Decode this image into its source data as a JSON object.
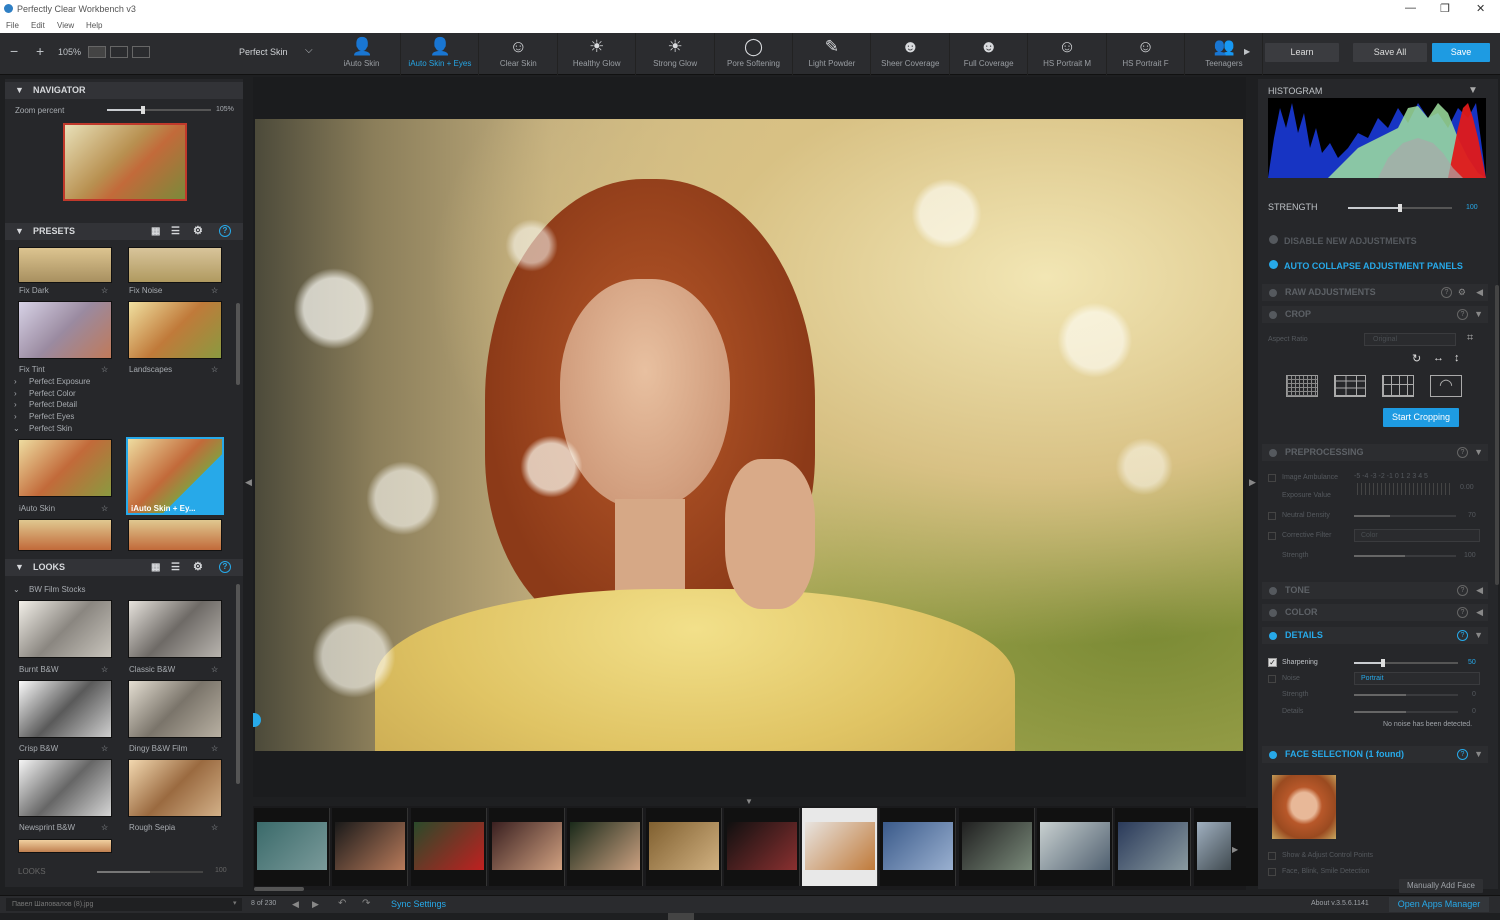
{
  "window": {
    "title": "Perfectly Clear Workbench v3",
    "min": "—",
    "max": "❐",
    "close": "✕"
  },
  "menu": [
    "File",
    "Edit",
    "View",
    "Help"
  ],
  "toolbar": {
    "zoom": "105%",
    "preset": "Perfect Skin",
    "tools": [
      {
        "label": "iAuto Skin",
        "icon": "👤"
      },
      {
        "label": "iAuto Skin + Eyes",
        "icon": "👤"
      },
      {
        "label": "Clear Skin",
        "icon": "☺"
      },
      {
        "label": "Healthy Glow",
        "icon": "☀"
      },
      {
        "label": "Strong Glow",
        "icon": "☀"
      },
      {
        "label": "Pore Softening",
        "icon": "◯"
      },
      {
        "label": "Light Powder",
        "icon": "✎"
      },
      {
        "label": "Sheer Coverage",
        "icon": "☻"
      },
      {
        "label": "Full Coverage",
        "icon": "☻"
      },
      {
        "label": "HS Portrait M",
        "icon": "☺"
      },
      {
        "label": "HS Portrait F",
        "icon": "☺"
      },
      {
        "label": "Teenagers",
        "icon": "👥"
      }
    ],
    "learn": "Learn",
    "save_all": "Save All",
    "save": "Save"
  },
  "navigator": {
    "title": "NAVIGATOR",
    "zoom_label": "Zoom percent",
    "zoom_value": "105%",
    "zoom_fraction": 0.35
  },
  "presets": {
    "title": "PRESETS",
    "items": [
      "Fix Dark",
      "Fix Noise",
      "Fix Tint",
      "Landscapes"
    ],
    "tree": [
      "Perfect Exposure",
      "Perfect Color",
      "Perfect Detail",
      "Perfect Eyes",
      "Perfect Skin"
    ],
    "skin": [
      "iAuto Skin",
      "iAuto Skin + Ey..."
    ]
  },
  "looks": {
    "title": "LOOKS",
    "group": "BW Film Stocks",
    "items": [
      "Burnt B&W",
      "Classic B&W",
      "Crisp B&W",
      "Dingy B&W Film",
      "Newsprint B&W",
      "Rough Sepia"
    ],
    "footer_label": "LOOKS",
    "footer_value": "100"
  },
  "right": {
    "histogram": "HISTOGRAM",
    "strength_label": "STRENGTH",
    "strength_value": "100",
    "strength_fraction": 0.5,
    "disable": "DISABLE NEW ADJUSTMENTS",
    "autocollapse": "AUTO COLLAPSE ADJUSTMENT PANELS",
    "raw": "RAW ADJUSTMENTS",
    "crop": "CROP",
    "aspect_label": "Aspect Ratio",
    "aspect_value": "Original",
    "start_crop": "Start Cropping",
    "pre": "PREPROCESSING",
    "image_amb": "Image Ambulance",
    "amb_scale": "-5 -4 -3 -2 -1 0 1 2 3 4 5",
    "amb_value": "0.00",
    "exposure": "Exposure Value",
    "neutral": "Neutral Density",
    "neutral_value": "70",
    "corrective": "Corrective Filter",
    "corrective_value": "Color",
    "strength": "Strength",
    "strength_val": "100",
    "tone": "TONE",
    "color": "COLOR",
    "details": "DETAILS",
    "sharpening": "Sharpening",
    "sharp_value": "50",
    "sharp_fraction": 0.28,
    "noise": "Noise",
    "noise_mode": "Portrait",
    "noise_strength": "Strength",
    "noise_detail": "Details",
    "zero": "0",
    "no_noise": "No noise has been detected.",
    "face": "FACE SELECTION (1 found)",
    "show_adjust": "Show & Adjust Control Points",
    "face_blink": "Face, Blink, Smile Detection",
    "manual_face": "Manually Add Face"
  },
  "status": {
    "filename": "Павел Шаповалов (8).jpg",
    "counter": "8 of 230",
    "sync": "Sync Settings",
    "about": "About v.3.5.6.1141",
    "open_apps": "Open Apps Manager"
  }
}
